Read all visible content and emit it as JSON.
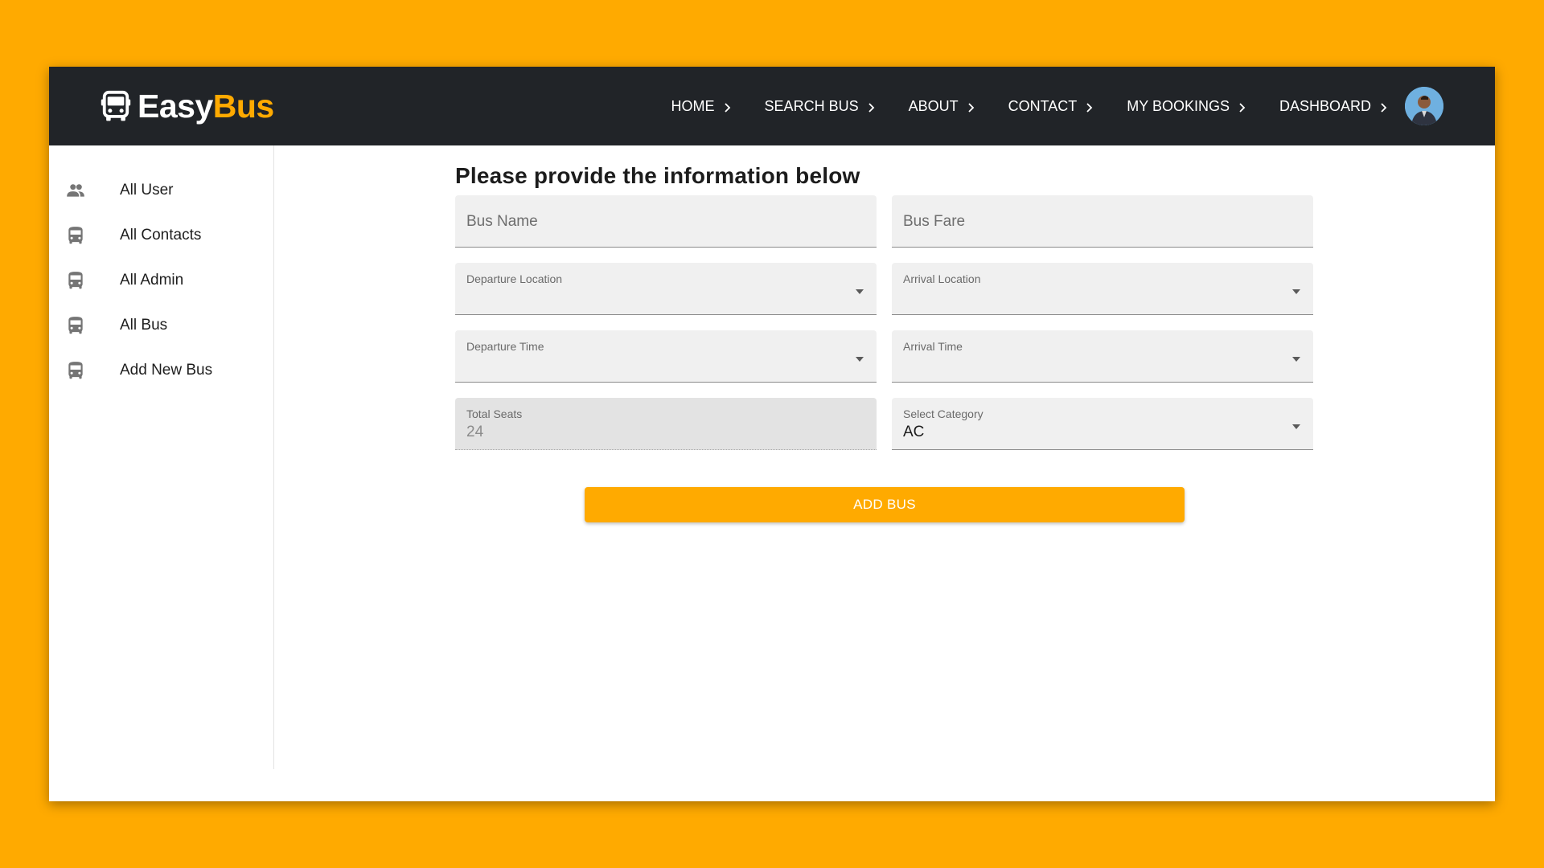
{
  "brand": {
    "part1": "Easy",
    "part2": "Bus",
    "icon": "bus-logo-icon"
  },
  "nav": {
    "items": [
      {
        "label": "HOME"
      },
      {
        "label": "SEARCH BUS"
      },
      {
        "label": "ABOUT"
      },
      {
        "label": "CONTACT"
      },
      {
        "label": "MY BOOKINGS"
      },
      {
        "label": "DASHBOARD"
      }
    ],
    "chevron_icon": "chevron-right-icon",
    "avatar_icon": "user-avatar"
  },
  "sidebar": {
    "items": [
      {
        "label": "All User",
        "icon": "group-icon"
      },
      {
        "label": "All Contacts",
        "icon": "bus-icon"
      },
      {
        "label": "All Admin",
        "icon": "bus-icon"
      },
      {
        "label": "All Bus",
        "icon": "bus-icon"
      },
      {
        "label": "Add New Bus",
        "icon": "bus-icon"
      }
    ]
  },
  "form": {
    "title": "Please provide the information below",
    "bus_name": {
      "placeholder": "Bus Name"
    },
    "bus_fare": {
      "placeholder": "Bus Fare"
    },
    "departure_location": {
      "label": "Departure Location",
      "value": ""
    },
    "arrival_location": {
      "label": "Arrival Location",
      "value": ""
    },
    "departure_time": {
      "label": "Departure Time",
      "value": ""
    },
    "arrival_time": {
      "label": "Arrival Time",
      "value": ""
    },
    "total_seats": {
      "label": "Total Seats",
      "value": "24"
    },
    "category": {
      "label": "Select Category",
      "value": "AC"
    },
    "submit_label": "ADD BUS"
  },
  "colors": {
    "accent": "#FFAA00",
    "navbar": "#212428",
    "field_bg": "#f0f0f0"
  }
}
